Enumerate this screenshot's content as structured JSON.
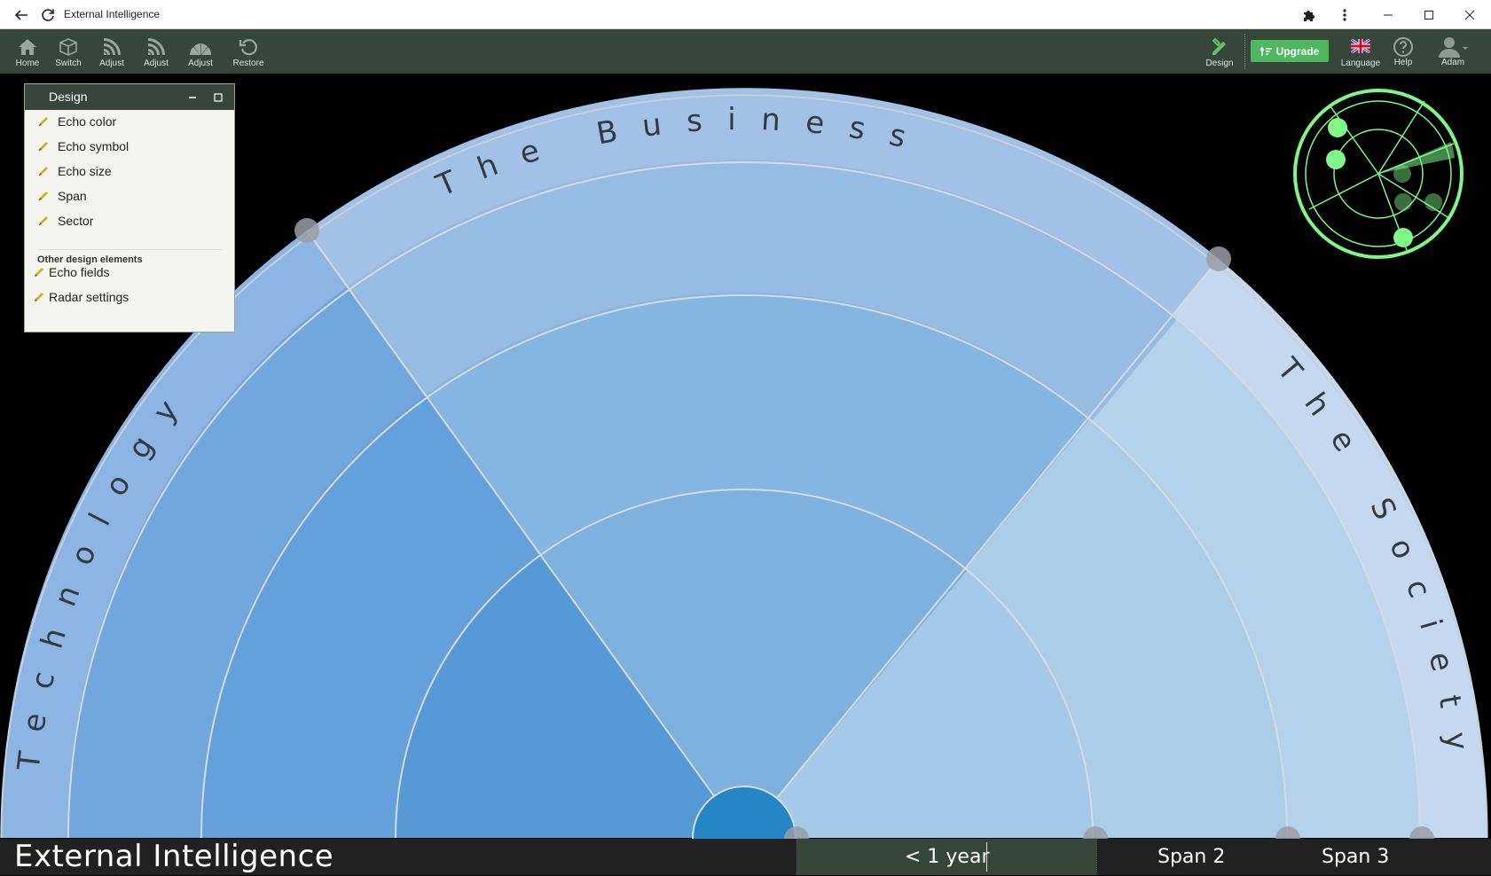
{
  "window": {
    "title": "External Intelligence"
  },
  "toolbar": {
    "items": [
      {
        "label": "Home",
        "icon": "home-icon"
      },
      {
        "label": "Switch",
        "icon": "cube-icon"
      },
      {
        "label": "Adjust",
        "icon": "rings-icon"
      },
      {
        "label": "Adjust",
        "icon": "rings-icon"
      },
      {
        "label": "Adjust",
        "icon": "sectors-icon"
      },
      {
        "label": "Restore",
        "icon": "restore-icon"
      }
    ],
    "design_label": "Design",
    "upgrade_label": "Upgrade",
    "language_label": "Language",
    "help_label": "Help",
    "user_label": "Adam"
  },
  "design_panel": {
    "title": "Design",
    "items": [
      "Echo color",
      "Echo symbol",
      "Echo size",
      "Span",
      "Sector"
    ],
    "other_heading": "Other design elements",
    "other_items": [
      "Echo fields",
      "Radar settings"
    ]
  },
  "radar": {
    "sectors": [
      "Technology",
      "The Business",
      "The Society"
    ]
  },
  "bottom": {
    "app_title": "External Intelligence",
    "spans": [
      "< 1 year",
      "Span 2",
      "Span 3"
    ]
  },
  "colors": {
    "toolbar_bg": "#36473a",
    "upgrade_bg": "#4fb760",
    "technology_inner": "#5599d6",
    "business_inner": "#7eb1de",
    "society_inner": "#a5c9e8",
    "hub": "#2486c4",
    "minimap": "#7ff58a"
  }
}
